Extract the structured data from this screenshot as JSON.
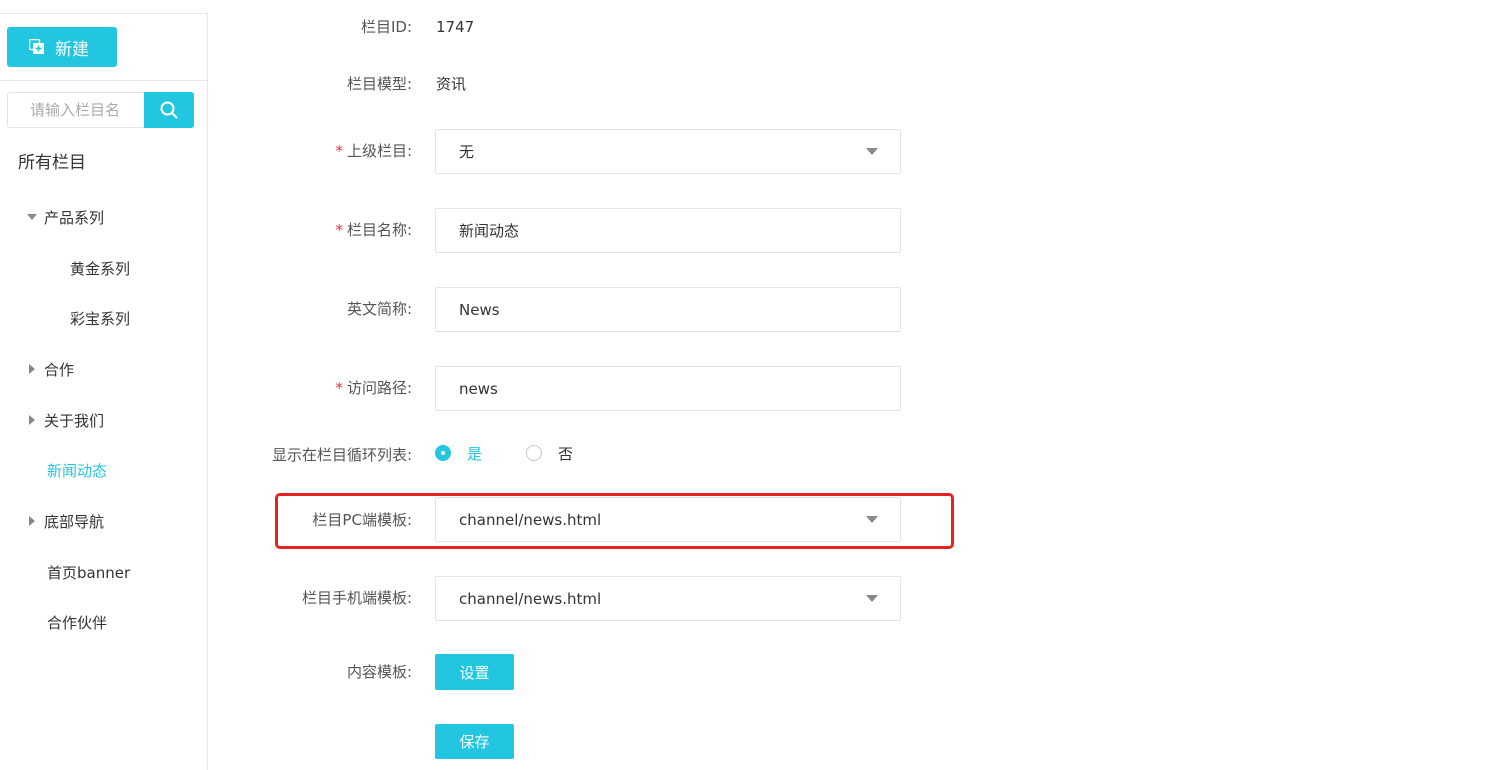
{
  "sidebar": {
    "new_label": "新建",
    "search_placeholder": "请输入栏目名",
    "tree_title": "所有栏目",
    "items": [
      {
        "label": "产品系列",
        "caret": "down"
      },
      {
        "label": "黄金系列",
        "caret": "none"
      },
      {
        "label": "彩宝系列",
        "caret": "none"
      },
      {
        "label": "合作",
        "caret": "right"
      },
      {
        "label": "关于我们",
        "caret": "right"
      },
      {
        "label": "新闻动态",
        "caret": "none",
        "active": true
      },
      {
        "label": "底部导航",
        "caret": "right"
      },
      {
        "label": "首页banner",
        "caret": "none"
      },
      {
        "label": "合作伙伴",
        "caret": "none"
      }
    ]
  },
  "form": {
    "id": {
      "label": "栏目ID:",
      "value": "1747"
    },
    "model": {
      "label": "栏目模型:",
      "value": "资讯"
    },
    "parent": {
      "label": "上级栏目:",
      "value": "无",
      "required_mark": "*"
    },
    "name": {
      "label": "栏目名称:",
      "value": "新闻动态",
      "required_mark": "*"
    },
    "en_name": {
      "label": "英文简称:",
      "value": "News"
    },
    "path": {
      "label": "访问路径:",
      "value": "news",
      "required_mark": "*"
    },
    "show_in_loop": {
      "label": "显示在栏目循环列表:",
      "options": [
        "是",
        "否"
      ],
      "selected": "是"
    },
    "pc_template": {
      "label": "栏目PC端模板:",
      "value": "channel/news.html"
    },
    "mobile_template": {
      "label": "栏目手机端模板:",
      "value": "channel/news.html"
    },
    "content_template": {
      "label": "内容模板:",
      "button": "设置"
    },
    "save_label": "保存"
  },
  "colors": {
    "accent": "#23c6e0",
    "required": "#ee3333",
    "highlight": "#e62222"
  }
}
